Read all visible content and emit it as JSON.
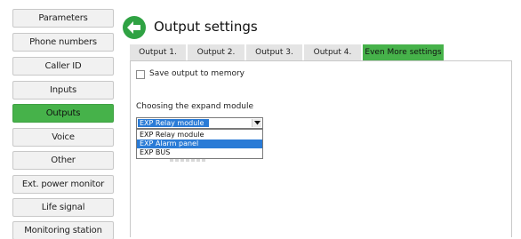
{
  "sidebar": {
    "items": [
      {
        "label": "Parameters",
        "active": false
      },
      {
        "label": "Phone numbers",
        "active": false
      },
      {
        "label": "Caller ID",
        "active": false
      },
      {
        "label": "Inputs",
        "active": false
      },
      {
        "label": "Outputs",
        "active": true
      },
      {
        "label": "Voice",
        "active": false
      },
      {
        "label": "Other",
        "active": false
      },
      {
        "label": "Ext. power monitor",
        "active": false
      },
      {
        "label": "Life signal",
        "active": false
      },
      {
        "label": "Monitoring station",
        "active": false
      }
    ]
  },
  "header": {
    "title": "Output settings",
    "icon": "back-arrow-icon"
  },
  "tabs": [
    {
      "label": "Output 1.",
      "active": false
    },
    {
      "label": "Output 2.",
      "active": false
    },
    {
      "label": "Output 3.",
      "active": false
    },
    {
      "label": "Output 4.",
      "active": false
    },
    {
      "label": "Even More settings",
      "active": true
    }
  ],
  "content": {
    "save_checkbox_label": "Save output to memory",
    "save_checked": false,
    "expand_label": "Choosing the expand module",
    "select_value": "EXP Relay module",
    "options": [
      {
        "label": "EXP Relay module",
        "highlighted": false
      },
      {
        "label": "EXP Alarm panel",
        "highlighted": true
      },
      {
        "label": "EXP BUS",
        "highlighted": false
      }
    ]
  },
  "colors": {
    "accent": "#46b24a",
    "selection": "#2a7bd6"
  }
}
